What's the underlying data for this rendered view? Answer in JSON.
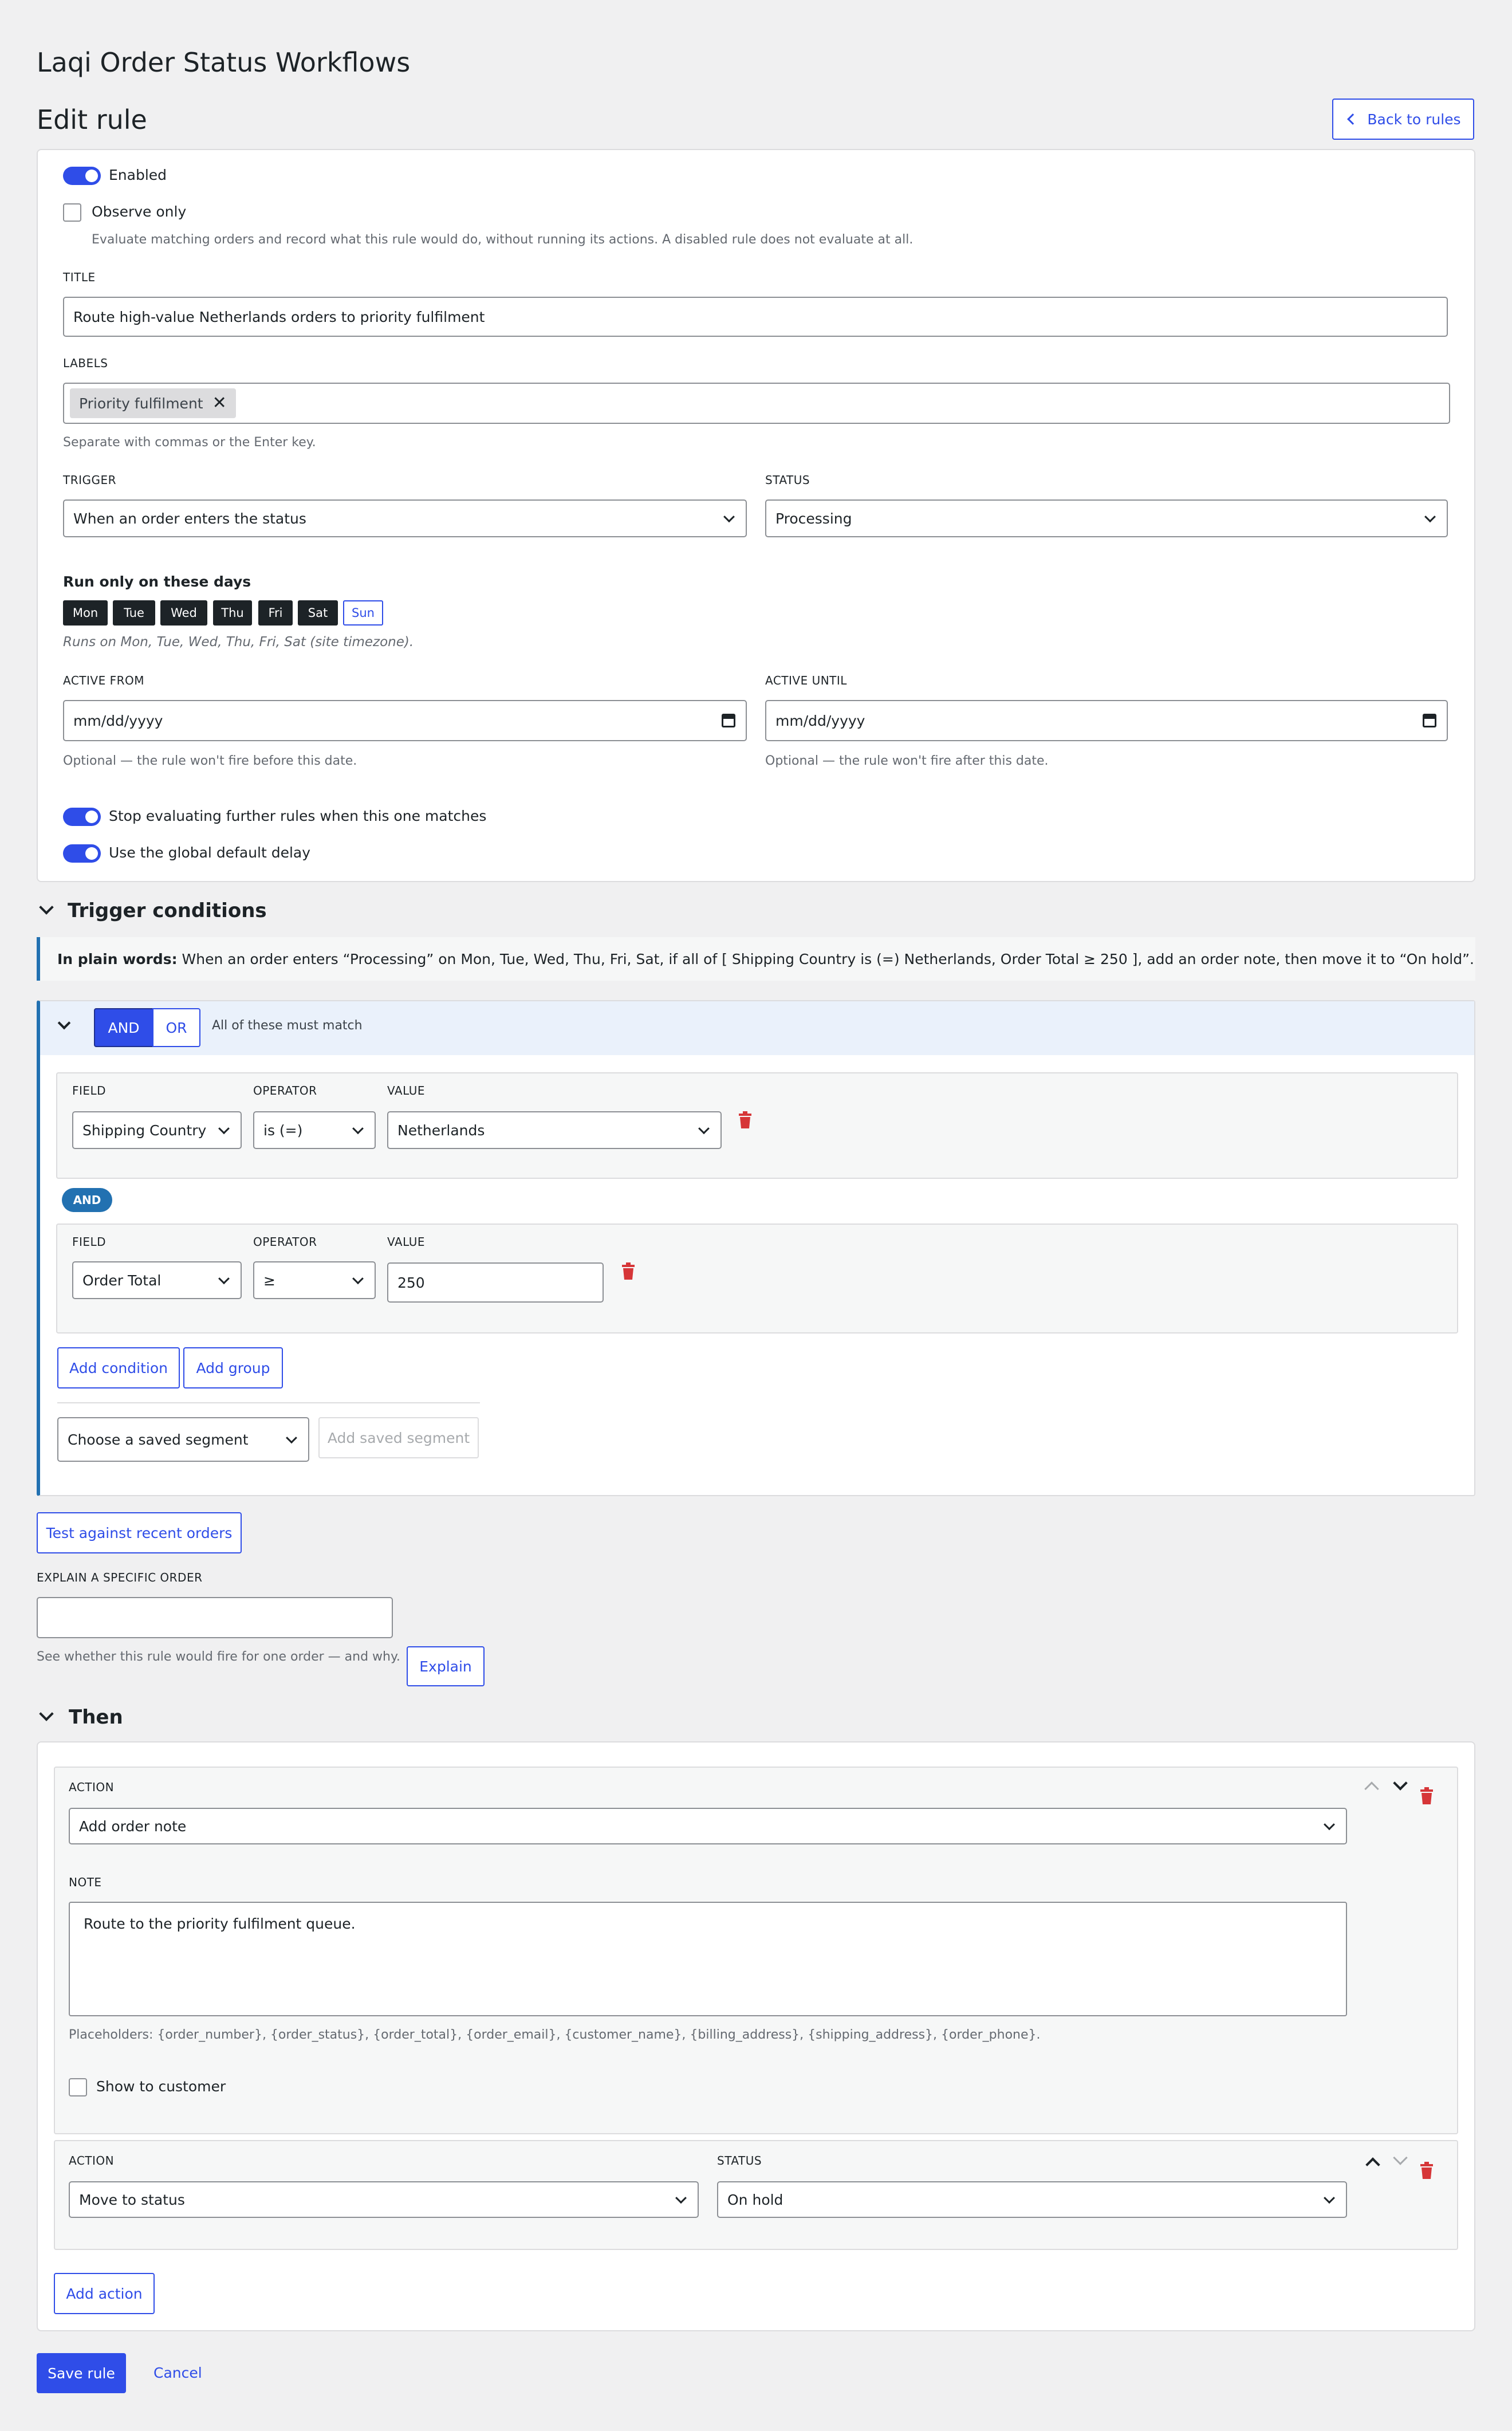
{
  "app_title": "Laqi Order Status Workflows",
  "page_title": "Edit rule",
  "back_button": "Back to rules",
  "settings": {
    "enabled_label": "Enabled",
    "observe_label": "Observe only",
    "observe_help": "Evaluate matching orders and record what this rule would do, without running its actions. A disabled rule does not evaluate at all.",
    "title_label": "TITLE",
    "title_value": "Route high-value Netherlands orders to priority fulfilment",
    "labels_label": "LABELS",
    "label_chip": "Priority fulfilment",
    "labels_help": "Separate with commas or the Enter key.",
    "trigger_label": "TRIGGER",
    "trigger_value": "When an order enters the status",
    "status_label": "STATUS",
    "status_value": "Processing",
    "days_heading": "Run only on these days",
    "days": [
      "Mon",
      "Tue",
      "Wed",
      "Thu",
      "Fri",
      "Sat",
      "Sun"
    ],
    "days_help": "Runs on Mon, Tue, Wed, Thu, Fri, Sat (site timezone).",
    "active_from_label": "ACTIVE FROM",
    "active_from_value": "mm/dd/yyyy",
    "active_from_help": "Optional — the rule won't fire before this date.",
    "active_until_label": "ACTIVE UNTIL",
    "active_until_value": "mm/dd/yyyy",
    "active_until_help": "Optional — the rule won't fire after this date.",
    "stop_label": "Stop evaluating further rules when this one matches",
    "delay_label": "Use the global default delay"
  },
  "conditions": {
    "heading": "Trigger conditions",
    "plain_bold": "In plain words:",
    "plain_text": " When an order enters “Processing” on Mon, Tue, Wed, Thu, Fri, Sat, if all of [ Shipping Country is (=) Netherlands, Order Total ≥ 250 ], add an order note, then move it to “On hold”.",
    "and_label": "AND",
    "or_label": "OR",
    "match_text": "All of these must match",
    "field_label": "FIELD",
    "operator_label": "OPERATOR",
    "value_label": "VALUE",
    "row1": {
      "field": "Shipping Country",
      "operator": "is (=)",
      "value": "Netherlands"
    },
    "connector": "AND",
    "row2": {
      "field": "Order Total",
      "operator": "≥",
      "value": "250"
    },
    "add_condition": "Add condition",
    "add_group": "Add group",
    "segment_placeholder": "Choose a saved segment",
    "add_segment": "Add saved segment"
  },
  "testing": {
    "test_button": "Test against recent orders",
    "explain_label": "EXPLAIN A SPECIFIC ORDER",
    "explain_value": "",
    "explain_help": "See whether this rule would fire for one order — and why.",
    "explain_button": "Explain"
  },
  "then": {
    "heading": "Then",
    "action_label": "ACTION",
    "action1_value": "Add order note",
    "note_label": "NOTE",
    "note_value": "Route to the priority fulfilment queue.",
    "placeholders_help": "Placeholders: {order_number}, {order_status}, {order_total}, {order_email}, {customer_name}, {billing_address}, {shipping_address}, {order_phone}.",
    "show_customer_label": "Show to customer",
    "action2_value": "Move to status",
    "status_label": "STATUS",
    "status2_value": "On hold",
    "add_action": "Add action"
  },
  "footer": {
    "save": "Save rule",
    "cancel": "Cancel"
  },
  "colors": {
    "accent": "#2f4de8",
    "danger": "#d63638",
    "connector": "#2271b1"
  }
}
